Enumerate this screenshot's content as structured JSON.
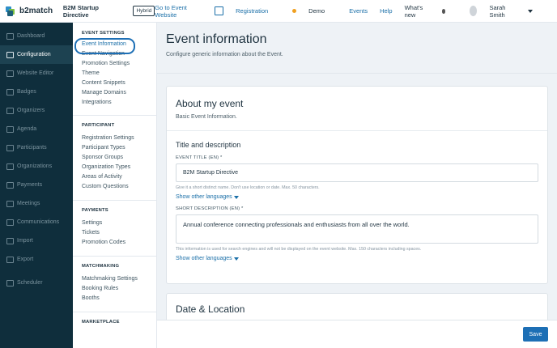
{
  "topbar": {
    "brand": "b2match",
    "event_name": "B2M Startup Directive",
    "badge": "Hybrid",
    "nav": {
      "go_to_event_website": "Go to Event Website",
      "registration": "Registration",
      "demo": "Demo",
      "events": "Events",
      "help": "Help",
      "whats_new": "What's new"
    },
    "user": "Sarah Smith",
    "logo_colors": [
      "#2e8fc8",
      "#7cc142",
      "#1d5f7a"
    ]
  },
  "leftnav": {
    "items": [
      {
        "label": "Dashboard",
        "icon": "dashboard-icon"
      },
      {
        "label": "Configuration",
        "icon": "gear-icon",
        "active": true
      },
      {
        "label": "Website Editor",
        "icon": "website-icon"
      },
      {
        "label": "Badges",
        "icon": "badge-icon"
      },
      {
        "label": "Organizers",
        "icon": "organizers-icon"
      },
      {
        "label": "Agenda",
        "icon": "agenda-icon"
      },
      {
        "label": "Participants",
        "icon": "participants-icon"
      },
      {
        "label": "Organizations",
        "icon": "organizations-icon"
      },
      {
        "label": "Payments",
        "icon": "payments-icon"
      },
      {
        "label": "Meetings",
        "icon": "meetings-icon"
      },
      {
        "label": "Communications",
        "icon": "communications-icon"
      },
      {
        "label": "Import",
        "icon": "import-icon"
      },
      {
        "label": "Export",
        "icon": "export-icon"
      },
      {
        "label": "Scheduler",
        "icon": "scheduler-icon"
      }
    ]
  },
  "settings": {
    "event_settings": {
      "title": "EVENT SETTINGS",
      "items": [
        "Event Information",
        "Event Navigation",
        "Promotion Settings",
        "Theme",
        "Content Snippets",
        "Manage Domains",
        "Integrations"
      ]
    },
    "participant": {
      "title": "PARTICIPANT",
      "items": [
        "Registration Settings",
        "Participant Types",
        "Sponsor Groups",
        "Organization Types",
        "Areas of Activity",
        "Custom Questions"
      ]
    },
    "payments": {
      "title": "PAYMENTS",
      "items": [
        "Settings",
        "Tickets",
        "Promotion Codes"
      ]
    },
    "matchmaking": {
      "title": "MATCHMAKING",
      "items": [
        "Matchmaking Settings",
        "Booking Rules",
        "Booths"
      ]
    },
    "marketplace": {
      "title": "MARKETPLACE"
    }
  },
  "main": {
    "title": "Event information",
    "subtitle": "Configure generic information about the Event.",
    "card": {
      "title": "About my event",
      "subtitle": "Basic Event Information.",
      "section_title": "Title and description",
      "event_title_label": "EVENT TITLE (EN) *",
      "event_title_value": "B2M Startup Directive",
      "event_title_hint": "Give it a short distinct name. Don't use location or date. Max. 50 characters.",
      "show_other_languages": "Show other languages",
      "short_desc_label": "SHORT DESCRIPTION (EN) *",
      "short_desc_value": "Annual conference connecting professionals and enthusiasts from all over the world.",
      "short_desc_hint": "This information is used for search engines and will not be displayed on the event website. Max. 150 characters including spaces."
    },
    "next_card_title": "Date & Location"
  },
  "footer": {
    "save": "Save"
  }
}
